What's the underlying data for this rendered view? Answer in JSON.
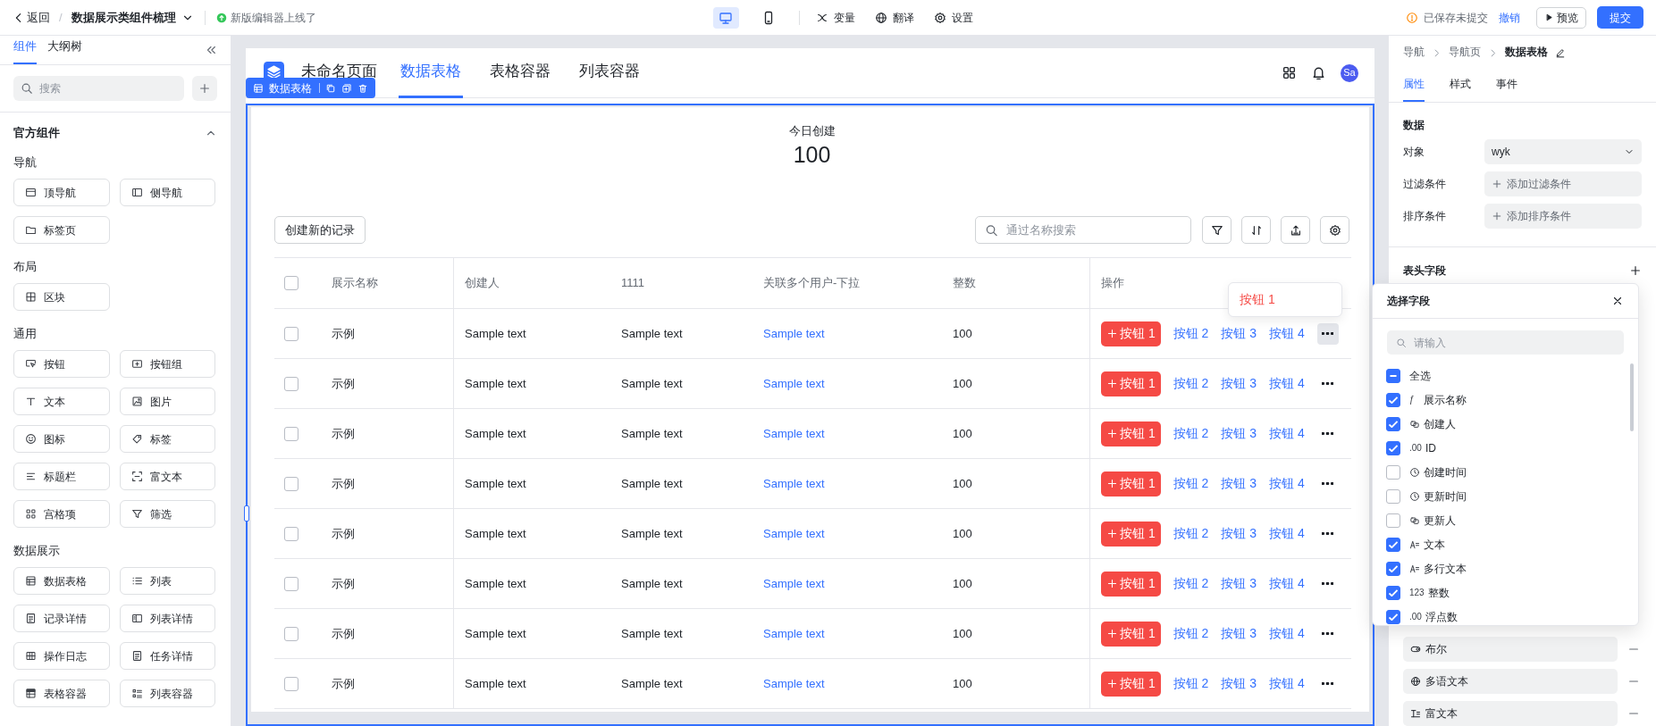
{
  "top_bar": {
    "back": "返回",
    "separator": "/",
    "project": "数据展示类组件梳理",
    "notice": "新版编辑器上线了",
    "devices": [
      {
        "kind": "desktop",
        "selected": true
      },
      {
        "kind": "mobile",
        "selected": false
      }
    ],
    "tools": [
      {
        "kind": "variable",
        "label": "变量"
      },
      {
        "kind": "globe",
        "label": "翻译"
      },
      {
        "kind": "gear",
        "label": "设置"
      }
    ],
    "save_status": "已保存未提交",
    "undo": "撤销",
    "preview": "预览",
    "submit": "提交"
  },
  "left_panel": {
    "tabs": [
      {
        "label": "组件",
        "selected": true
      },
      {
        "label": "大纲树",
        "selected": false
      }
    ],
    "search": {
      "placeholder": "搜索"
    },
    "section": {
      "title": "官方组件",
      "expanded": true,
      "groups": [
        {
          "title": "导航",
          "items": [
            {
              "label": "顶导航",
              "kind": "topnav"
            },
            {
              "label": "侧导航",
              "kind": "sidenav"
            },
            {
              "label": "标签页",
              "kind": "tabs"
            }
          ]
        },
        {
          "title": "布局",
          "items": [
            {
              "label": "区块",
              "kind": "block"
            }
          ]
        },
        {
          "title": "通用",
          "items": [
            {
              "label": "按钮",
              "kind": "button"
            },
            {
              "label": "按钮组",
              "kind": "buttongroup"
            },
            {
              "label": "文本",
              "kind": "text"
            },
            {
              "label": "图片",
              "kind": "image"
            },
            {
              "label": "图标",
              "kind": "icon"
            },
            {
              "label": "标签",
              "kind": "tag"
            },
            {
              "label": "标题栏",
              "kind": "titlebar"
            },
            {
              "label": "富文本",
              "kind": "richtext"
            },
            {
              "label": "宫格项",
              "kind": "griditem"
            },
            {
              "label": "筛选",
              "kind": "filter"
            }
          ]
        },
        {
          "title": "数据展示",
          "items": [
            {
              "label": "数据表格",
              "kind": "table"
            },
            {
              "label": "列表",
              "kind": "list"
            },
            {
              "label": "记录详情",
              "kind": "record"
            },
            {
              "label": "列表详情",
              "kind": "listdetail"
            },
            {
              "label": "操作日志",
              "kind": "log"
            },
            {
              "label": "任务详情",
              "kind": "task"
            },
            {
              "label": "表格容器",
              "kind": "tablebox"
            },
            {
              "label": "列表容器",
              "kind": "listbox"
            }
          ]
        }
      ]
    }
  },
  "canvas": {
    "page": {
      "title": "未命名页面",
      "nav": [
        {
          "label": "数据表格",
          "selected": true
        },
        {
          "label": "表格容器",
          "selected": false
        },
        {
          "label": "列表容器",
          "selected": false
        }
      ],
      "avatar": "Sa"
    },
    "selection_tag": {
      "label": "数据表格"
    },
    "summary": {
      "label": "今日创建",
      "value": "100"
    },
    "create_button": "创建新的记录",
    "search": {
      "placeholder": "通过名称搜索"
    },
    "table": {
      "header_checked": false,
      "columns": [
        {
          "label": "展示名称",
          "kind": "text"
        },
        {
          "label": "创建人",
          "kind": "text"
        },
        {
          "label": "1111",
          "kind": "text"
        },
        {
          "label": "关联多个用户-下拉",
          "kind": "link"
        },
        {
          "label": "整数",
          "kind": "text"
        },
        {
          "label": "操作",
          "kind": "actions"
        }
      ],
      "rows": [
        {
          "checked": false,
          "more_active": true,
          "cells": [
            "示例",
            "Sample text",
            "Sample text",
            "Sample text",
            "100"
          ],
          "actions": [
            "按钮 1",
            "按钮 2",
            "按钮 3",
            "按钮 4"
          ]
        },
        {
          "checked": false,
          "more_active": false,
          "cells": [
            "示例",
            "Sample text",
            "Sample text",
            "Sample text",
            "100"
          ],
          "actions": [
            "按钮 1",
            "按钮 2",
            "按钮 3",
            "按钮 4"
          ]
        },
        {
          "checked": false,
          "more_active": false,
          "cells": [
            "示例",
            "Sample text",
            "Sample text",
            "Sample text",
            "100"
          ],
          "actions": [
            "按钮 1",
            "按钮 2",
            "按钮 3",
            "按钮 4"
          ]
        },
        {
          "checked": false,
          "more_active": false,
          "cells": [
            "示例",
            "Sample text",
            "Sample text",
            "Sample text",
            "100"
          ],
          "actions": [
            "按钮 1",
            "按钮 2",
            "按钮 3",
            "按钮 4"
          ]
        },
        {
          "checked": false,
          "more_active": false,
          "cells": [
            "示例",
            "Sample text",
            "Sample text",
            "Sample text",
            "100"
          ],
          "actions": [
            "按钮 1",
            "按钮 2",
            "按钮 3",
            "按钮 4"
          ]
        },
        {
          "checked": false,
          "more_active": false,
          "cells": [
            "示例",
            "Sample text",
            "Sample text",
            "Sample text",
            "100"
          ],
          "actions": [
            "按钮 1",
            "按钮 2",
            "按钮 3",
            "按钮 4"
          ]
        },
        {
          "checked": false,
          "more_active": false,
          "cells": [
            "示例",
            "Sample text",
            "Sample text",
            "Sample text",
            "100"
          ],
          "actions": [
            "按钮 1",
            "按钮 2",
            "按钮 3",
            "按钮 4"
          ]
        },
        {
          "checked": false,
          "more_active": false,
          "cells": [
            "示例",
            "Sample text",
            "Sample text",
            "Sample text",
            "100"
          ],
          "actions": [
            "按钮 1",
            "按钮 2",
            "按钮 3",
            "按钮 4"
          ]
        }
      ]
    },
    "action_menu": {
      "items": [
        "按钮 1"
      ]
    }
  },
  "right_panel": {
    "breadcrumb": [
      "导航",
      "导航页",
      "数据表格"
    ],
    "tabs": [
      {
        "label": "属性",
        "selected": true
      },
      {
        "label": "样式",
        "selected": false
      },
      {
        "label": "事件",
        "selected": false
      }
    ],
    "data_section": {
      "title": "数据",
      "rows": [
        {
          "label": "对象",
          "kind": "select",
          "value": "wyk"
        },
        {
          "label": "过滤条件",
          "kind": "add",
          "action": "添加过滤条件"
        },
        {
          "label": "排序条件",
          "kind": "add",
          "action": "添加排序条件"
        }
      ]
    },
    "header_fields": {
      "title": "表头字段",
      "items": [
        {
          "label": "布尔",
          "kind": "boolean"
        },
        {
          "label": "多语文本",
          "kind": "multilang"
        },
        {
          "label": "富文本",
          "kind": "richtext"
        }
      ]
    }
  },
  "field_picker": {
    "title": "选择字段",
    "search": {
      "placeholder": "请输入"
    },
    "select_all": {
      "label": "全选",
      "indeterminate": true
    },
    "fields": [
      {
        "label": "展示名称",
        "kind": "formula",
        "type_text": "ƒ",
        "checked": true
      },
      {
        "label": "创建人",
        "kind": "user",
        "checked": true
      },
      {
        "label": "ID",
        "kind": "decimal",
        "type_text": ".00",
        "checked": true
      },
      {
        "label": "创建时间",
        "kind": "time",
        "checked": false
      },
      {
        "label": "更新时间",
        "kind": "time",
        "checked": false
      },
      {
        "label": "更新人",
        "kind": "user",
        "checked": false
      },
      {
        "label": "文本",
        "kind": "text",
        "checked": true
      },
      {
        "label": "多行文本",
        "kind": "text",
        "checked": true
      },
      {
        "label": "整数",
        "kind": "integer",
        "type_text": "123",
        "checked": true
      },
      {
        "label": "浮点数",
        "kind": "decimal",
        "type_text": ".00",
        "checked": true
      }
    ]
  }
}
